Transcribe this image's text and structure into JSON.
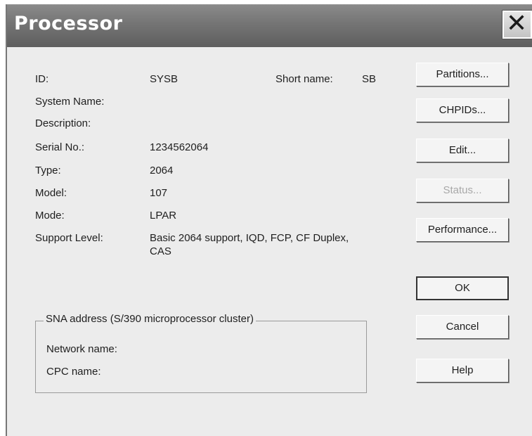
{
  "window": {
    "title": "Processor",
    "close_glyph": "✕"
  },
  "fields": {
    "id_label": "ID:",
    "id_value": "SYSB",
    "short_name_label": "Short name:",
    "short_name_value": "SB",
    "system_name_label": "System Name:",
    "description_label": "Description:",
    "serial_label": "Serial No.:",
    "serial_value": "1234562064",
    "type_label": "Type:",
    "type_value": "2064",
    "model_label": "Model:",
    "model_value": "107",
    "mode_label": "Mode:",
    "mode_value": "LPAR",
    "support_label": "Support Level:",
    "support_value": "Basic 2064 support, IQD, FCP, CF Duplex, CAS"
  },
  "sna": {
    "group_label": "SNA address (S/390 microprocessor cluster)",
    "network_label": "Network name:",
    "cpc_label": "CPC name:"
  },
  "buttons": {
    "partitions": "Partitions...",
    "chpids": "CHPIDs...",
    "edit": "Edit...",
    "status": "Status...",
    "performance": "Performance...",
    "ok": "OK",
    "cancel": "Cancel",
    "help": "Help"
  },
  "icons": {
    "close": "close-icon"
  }
}
